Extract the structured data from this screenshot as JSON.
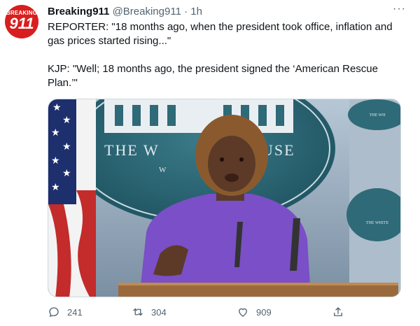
{
  "author": {
    "display_name": "Breaking911",
    "handle": "@Breaking911",
    "separator": "·",
    "time": "1h",
    "avatar_text_top": "BREAKING",
    "avatar_text_main": "911"
  },
  "tweet": {
    "paragraph_1": "REPORTER: \"18 months ago, when the president took office, inflation and gas prices started rising...\"",
    "paragraph_2": "KJP: \"Well; 18 months ago, the president signed the ‘American Rescue Plan.’\""
  },
  "media": {
    "backdrop_text": "THE W",
    "backdrop_text_2": "USE",
    "backdrop_text_3": "W",
    "side_seal_text": "THE WH",
    "side_seal_text_2": "THE WHITE"
  },
  "actions": {
    "reply_count": "241",
    "retweet_count": "304",
    "like_count": "909"
  },
  "more_icon": "more-horizontal-icon",
  "colors": {
    "accent": "#1d9bf0",
    "avatar_bg": "#d81e1e",
    "secondary_text": "#536471"
  }
}
